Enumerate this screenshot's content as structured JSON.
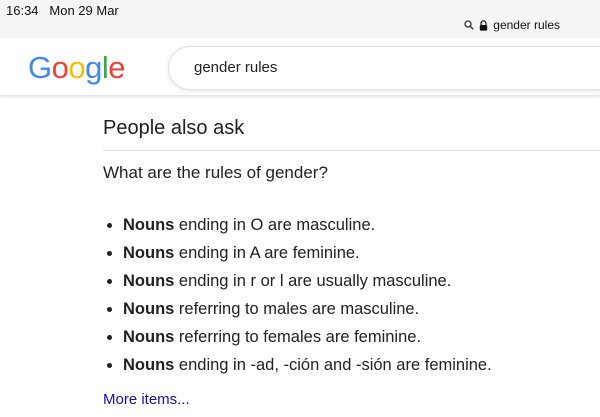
{
  "statusbar": {
    "time": "16:34",
    "date": "Mon 29 Mar"
  },
  "browser": {
    "url": "gender rules",
    "search_icon": "search-icon",
    "lock_icon": "lock-icon"
  },
  "header": {
    "logo_letters": [
      "G",
      "o",
      "o",
      "g",
      "l",
      "e"
    ],
    "search_query": "gender rules"
  },
  "paa": {
    "title": "People also ask",
    "question": "What are the rules of gender?",
    "items": [
      {
        "bold": "Nouns",
        "text": " ending in O are masculine."
      },
      {
        "bold": "Nouns",
        "text": " ending in A are feminine."
      },
      {
        "bold": "Nouns",
        "text": " ending in r or l are usually masculine."
      },
      {
        "bold": "Nouns",
        "text": " referring to males are masculine."
      },
      {
        "bold": "Nouns",
        "text": " referring to females are feminine."
      },
      {
        "bold": "Nouns",
        "text": " ending in -ad, -ción and -sión are feminine."
      }
    ],
    "more_link": "More items..."
  },
  "colors": {
    "link": "#1a0dab",
    "g_blue": "#4285F4",
    "g_red": "#EA4335",
    "g_yellow": "#FBBC05",
    "g_green": "#34A853"
  }
}
